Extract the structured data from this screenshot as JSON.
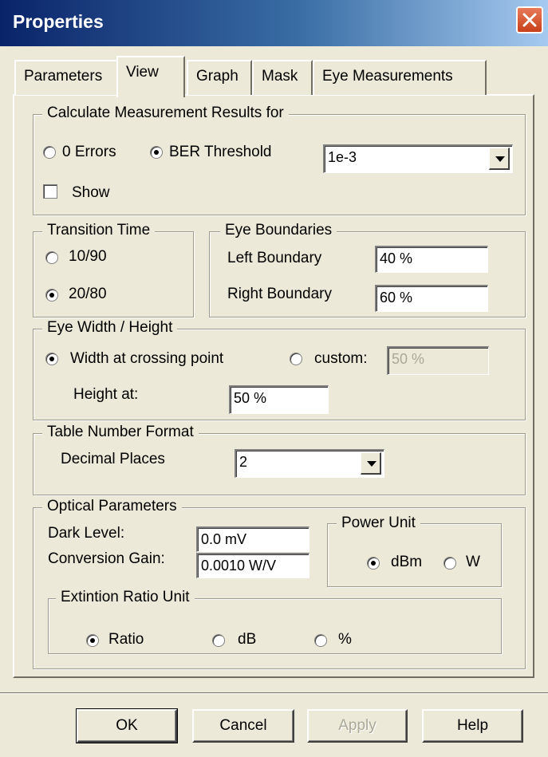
{
  "window": {
    "title": "Properties"
  },
  "tabs": [
    "Parameters",
    "View",
    "Graph",
    "Mask",
    "Eye Measurements"
  ],
  "active_tab": "View",
  "calc": {
    "legend": "Calculate Measurement Results for",
    "opt_zero": "0 Errors",
    "opt_ber": "BER Threshold",
    "selected": "BER Threshold",
    "ber_value": "1e-3",
    "show_label": "Show",
    "show_checked": false
  },
  "transition": {
    "legend": "Transition Time",
    "opt1": "10/90",
    "opt2": "20/80",
    "selected": "20/80"
  },
  "eye_boundaries": {
    "legend": "Eye Boundaries",
    "left_label": "Left Boundary",
    "left_value": "40 %",
    "right_label": "Right Boundary",
    "right_value": "60 %"
  },
  "eye_width": {
    "legend": "Eye Width / Height",
    "opt_crossing": "Width at crossing point",
    "opt_custom": "custom:",
    "selected": "Width at crossing point",
    "custom_value": "50 %",
    "height_label": "Height at:",
    "height_value": "50 %"
  },
  "table_format": {
    "legend": "Table Number Format",
    "decimal_label": "Decimal Places",
    "decimal_value": "2"
  },
  "optical": {
    "legend": "Optical Parameters",
    "dark_label": "Dark Level:",
    "dark_value": "0.0 mV",
    "gain_label": "Conversion Gain:",
    "gain_value": "0.0010 W/V",
    "power_legend": "Power Unit",
    "power_dbm": "dBm",
    "power_w": "W",
    "power_selected": "dBm",
    "ext_legend": "Extintion Ratio Unit",
    "ext_ratio": "Ratio",
    "ext_db": "dB",
    "ext_pct": "%",
    "ext_selected": "Ratio"
  },
  "buttons": {
    "ok": "OK",
    "cancel": "Cancel",
    "apply": "Apply",
    "help": "Help"
  },
  "colors": {
    "titlebar_start": "#0a246a",
    "titlebar_end": "#a6caf0",
    "close": "#c8401a",
    "face": "#ece9d8"
  }
}
